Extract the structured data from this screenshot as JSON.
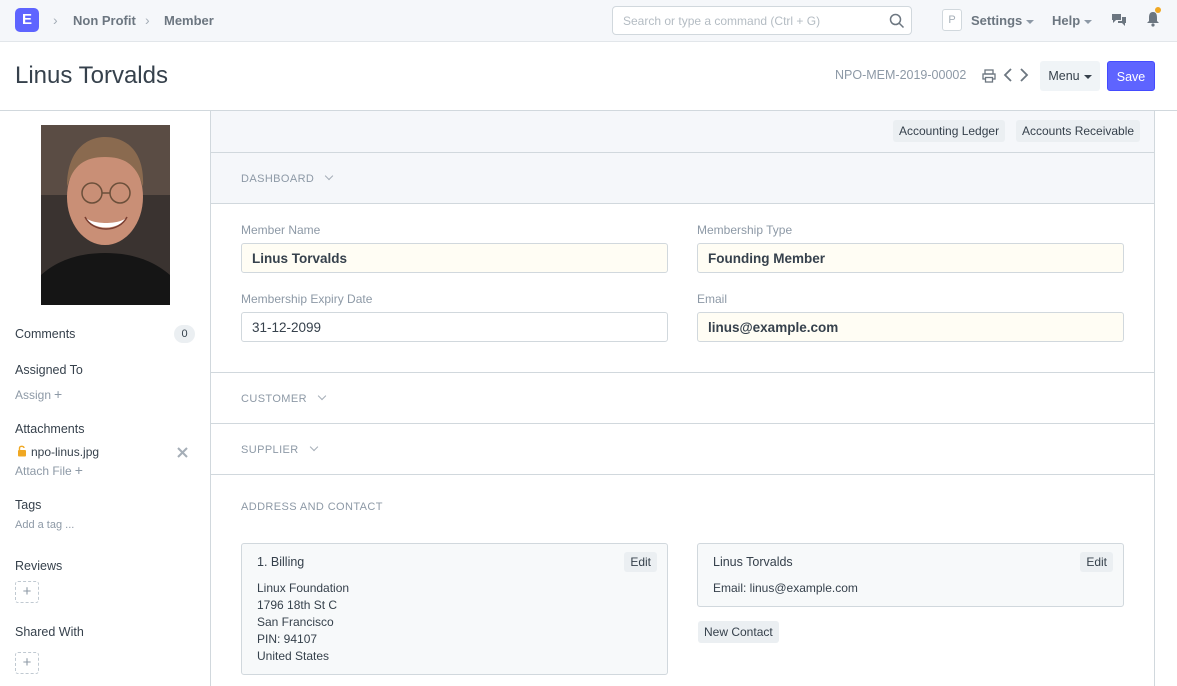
{
  "navbar": {
    "logo_letter": "E",
    "breadcrumbs": [
      "Non Profit",
      "Member"
    ],
    "search_placeholder": "Search or type a command (Ctrl + G)",
    "avatar_letter": "P",
    "settings_label": "Settings",
    "help_label": "Help",
    "accent_color": "#5e64ff",
    "notification_dot_color": "#f0a823"
  },
  "page": {
    "title": "Linus Torvalds",
    "doc_id": "NPO-MEM-2019-00002",
    "menu_label": "Menu",
    "save_label": "Save"
  },
  "sidebar": {
    "comments_label": "Comments",
    "comments_count": "0",
    "assigned_label": "Assigned To",
    "assign_link": "Assign",
    "attachments_label": "Attachments",
    "attachment_name": "npo-linus.jpg",
    "attach_file_link": "Attach File",
    "tags_label": "Tags",
    "add_tag_link": "Add a tag ...",
    "reviews_label": "Reviews",
    "shared_label": "Shared With"
  },
  "form": {
    "links": [
      "Accounting Ledger",
      "Accounts Receivable"
    ],
    "dashboard_title": "DASHBOARD",
    "fields": {
      "member_name_label": "Member Name",
      "member_name": "Linus Torvalds",
      "membership_type_label": "Membership Type",
      "membership_type": "Founding Member",
      "expiry_label": "Membership Expiry Date",
      "expiry": "31-12-2099",
      "email_label": "Email",
      "email": "linus@example.com"
    },
    "customer_title": "CUSTOMER",
    "supplier_title": "SUPPLIER",
    "address_title": "ADDRESS AND CONTACT",
    "address_card": {
      "title": "1. Billing",
      "edit_label": "Edit",
      "lines": [
        "Linux Foundation",
        "1796 18th St C",
        "San Francisco",
        "PIN: 94107",
        "United States"
      ]
    },
    "contact_card": {
      "title": "Linus Torvalds",
      "edit_label": "Edit",
      "email_line": "Email: linus@example.com"
    },
    "new_contact_label": "New Contact"
  }
}
